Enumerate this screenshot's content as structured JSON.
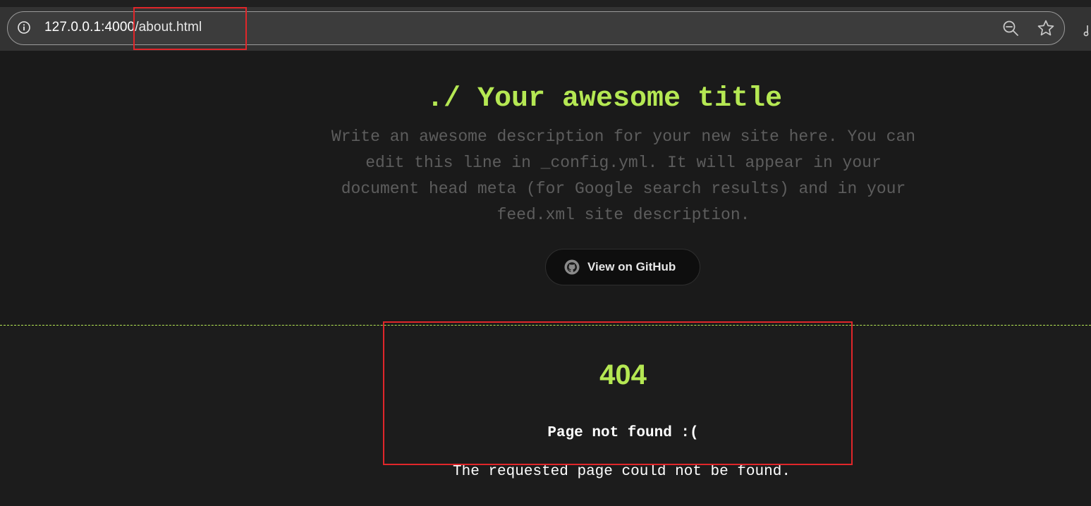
{
  "browser": {
    "url_host": "127.0.0.1:4000",
    "url_path": "/about.html",
    "icons": {
      "site_info": "info-icon",
      "zoom": "zoom-out-icon",
      "bookmark": "star-icon"
    }
  },
  "header": {
    "title": "./ Your awesome title",
    "description": "Write an awesome description for your new site here. You can edit this line in _config.yml. It will appear in your document head meta (for Google search results) and in your feed.xml site description.",
    "github_button_label": "View on GitHub"
  },
  "content": {
    "error_code": "404",
    "error_title": "Page not found :(",
    "error_message": "The requested page could not be found."
  },
  "colors": {
    "accent": "#b5e853",
    "background": "#1c1c1c",
    "highlight": "#e0262a"
  }
}
